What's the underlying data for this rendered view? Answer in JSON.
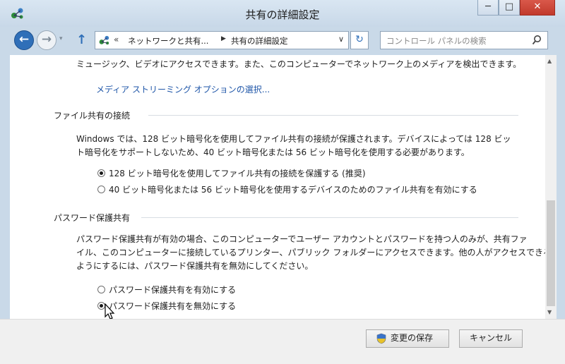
{
  "window": {
    "title": "共有の詳細設定",
    "minimize": "─",
    "maximize": "□",
    "close": "✕"
  },
  "nav": {
    "back_glyph": "←",
    "forward_glyph": "→",
    "history_glyph": "▾",
    "up_glyph": "↑",
    "address": {
      "chevrons": "«",
      "crumb1": "ネットワークと共有...",
      "separator": "▶",
      "crumb2": "共有の詳細設定",
      "dropdown_glyph": "∨"
    },
    "refresh_glyph": "↻",
    "search_placeholder": "コントロール パネルの検索"
  },
  "content": {
    "media_text": "ミュージック、ビデオにアクセスできます。また、このコンピューターでネットワーク上のメディアを検出できます。",
    "media_link": "メディア ストリーミング オプションの選択...",
    "file_sharing": {
      "heading": "ファイル共有の接続",
      "desc_line1": "Windows では、128 ビット暗号化を使用してファイル共有の接続が保護されます。デバイスによっては 128 ビッ",
      "desc_line2": "ト暗号化をサポートしないため、40 ビット暗号化または 56 ビット暗号化を使用する必要があります。",
      "options": [
        {
          "label": "128 ビット暗号化を使用してファイル共有の接続を保護する (推奨)",
          "selected": true
        },
        {
          "label": "40 ビット暗号化または 56 ビット暗号化を使用するデバイスのためのファイル共有を有効にする",
          "selected": false
        }
      ]
    },
    "password": {
      "heading": "パスワード保護共有",
      "desc_line1": "パスワード保護共有が有効の場合、このコンピューターでユーザー アカウントとパスワードを持つ人のみが、共有ファ",
      "desc_line2": "イル、このコンピューターに接続しているプリンター、パブリック フォルダーにアクセスできます。他の人がアクセスできる",
      "desc_line3": "ようにするには、パスワード保護共有を無効にしてください。",
      "options": [
        {
          "label": "パスワード保護共有を有効にする",
          "selected": false
        },
        {
          "label": "パスワード保護共有を無効にする",
          "selected": true
        }
      ]
    }
  },
  "scrollbar": {
    "up_glyph": "▲",
    "down_glyph": "▼"
  },
  "footer": {
    "save_label": "変更の保存",
    "cancel_label": "キャンセル"
  }
}
